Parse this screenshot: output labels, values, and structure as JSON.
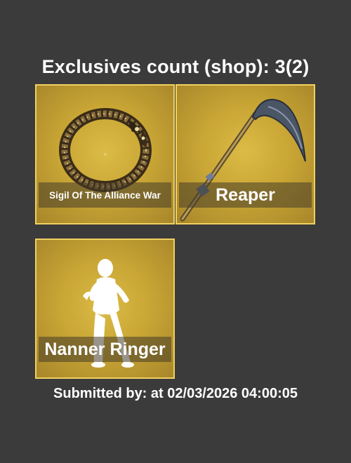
{
  "header": {
    "title": "Exclusives count (shop): 3(2)"
  },
  "items": [
    {
      "name": "Sigil Of The Alliance War",
      "icon": "ring-sigil-icon"
    },
    {
      "name": "Reaper",
      "icon": "scythe-icon"
    },
    {
      "name": "Nanner Ringer",
      "icon": "dancer-emote-icon"
    }
  ],
  "footer": {
    "prefix": "Submitted by:",
    "submitter": "",
    "timestamp_text": "at 02/03/2026 04:00:05"
  },
  "colors": {
    "background": "#3b3b3b",
    "card_gold": "#c9a635",
    "card_border": "#f0d060"
  }
}
